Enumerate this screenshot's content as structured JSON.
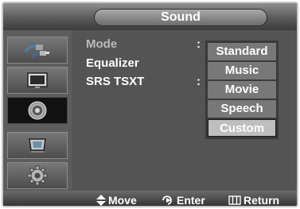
{
  "header": {
    "title": "Sound"
  },
  "sidebar": {
    "items": [
      {
        "icon": "input-plug-icon",
        "active": false
      },
      {
        "icon": "picture-icon",
        "active": false
      },
      {
        "icon": "speaker-icon",
        "active": true
      },
      {
        "icon": "channel-icon",
        "active": false
      },
      {
        "icon": "setup-gear-icon",
        "active": false
      }
    ]
  },
  "menu": {
    "rows": [
      {
        "label": "Mode",
        "colon": ":"
      },
      {
        "label": "Equalizer",
        "colon": ""
      },
      {
        "label": "SRS TSXT",
        "colon": ":"
      }
    ],
    "mode_options": [
      "Standard",
      "Music",
      "Movie",
      "Speech",
      "Custom"
    ],
    "mode_selected": "Custom"
  },
  "footer": {
    "move": "Move",
    "enter": "Enter",
    "return": "Return"
  }
}
